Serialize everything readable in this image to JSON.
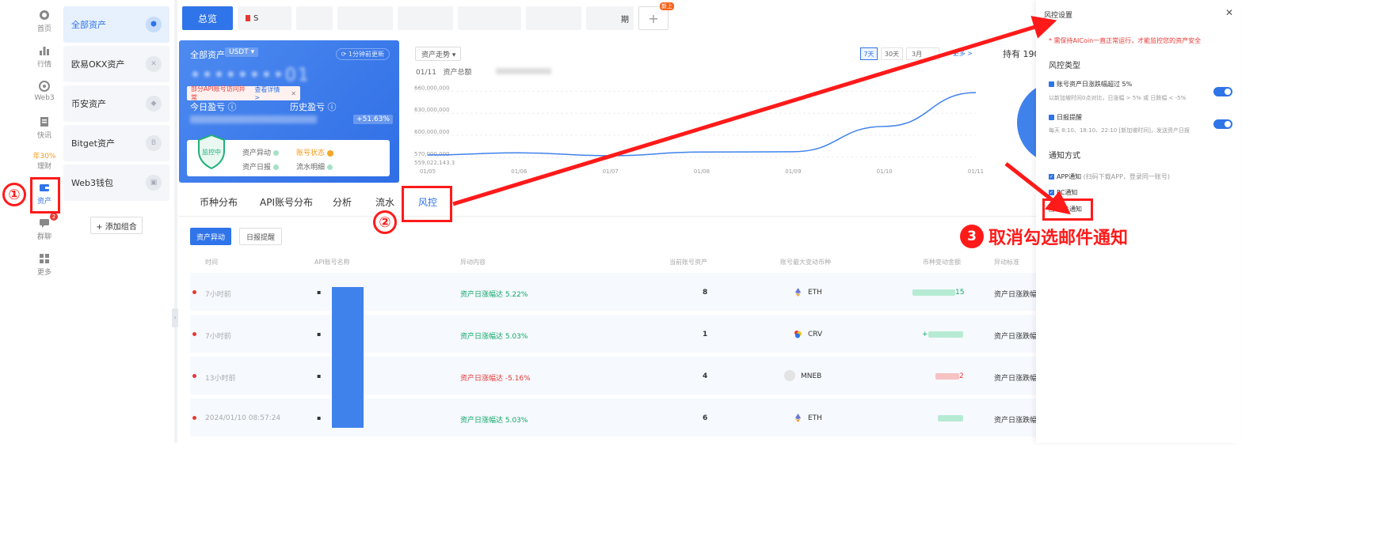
{
  "nav": [
    {
      "label": "首页",
      "icon": "home-icon"
    },
    {
      "label": "行情",
      "icon": "market-icon"
    },
    {
      "label": "Web3",
      "icon": "web3-icon"
    },
    {
      "label": "快讯",
      "icon": "news-icon"
    },
    {
      "annual": "年30%",
      "label": "理财",
      "icon": "finance-icon"
    },
    {
      "label": "资产",
      "icon": "wallet-icon"
    },
    {
      "label": "群聊",
      "icon": "chat-icon",
      "badge": "2"
    },
    {
      "label": "更多",
      "icon": "more-icon"
    }
  ],
  "accounts": [
    {
      "label": "全部资产",
      "badge": "⬢"
    },
    {
      "label": "欧易OKX资产",
      "badge": "✕"
    },
    {
      "label": "币安资产",
      "badge": "◆"
    },
    {
      "label": "Bitget资产",
      "badge": "B"
    },
    {
      "label": "Web3钱包",
      "badge": "▣"
    }
  ],
  "add_group": "+ 添加组合",
  "tabs": {
    "overview": "总览",
    "first_partial": "S",
    "last_partial": "期",
    "new_tag": "新上"
  },
  "summary": {
    "title": "全部资产",
    "unit": "USDT ▾",
    "refresh": "1分钟前更新",
    "amount_visible": "01",
    "alert": "部分API账号访问异常",
    "alert_link": "查看详情 >",
    "today_pnl": "今日盈亏",
    "history_pnl": "历史盈亏",
    "pct": "+51.63%",
    "shield": "监控中",
    "items": [
      "资产异动",
      "账号状态",
      "资产日报",
      "流水明细"
    ]
  },
  "chart_card": {
    "select": "资产走势 ▾",
    "date": "01/11",
    "total_label": "资产总额",
    "ranges": [
      "7天",
      "30天",
      "3月"
    ],
    "more": "更多 >"
  },
  "chart_data": {
    "type": "line",
    "x": [
      "01/05",
      "01/06",
      "01/07",
      "01/08",
      "01/09",
      "01/10",
      "01/11"
    ],
    "series": [
      {
        "values": [
          573000000,
          576000000,
          572000000,
          577000000,
          577500000,
          612000000,
          658000000
        ]
      }
    ],
    "y_ticks": [
      "660,000,000",
      "630,000,000",
      "600,000,000",
      "570,000,000"
    ],
    "ymin_label": "559,022,143.3",
    "ylim": [
      559000000,
      670000000
    ],
    "color": "#3f82ec"
  },
  "holdings": {
    "title": "持有 190"
  },
  "subtabs": [
    "币种分布",
    "API账号分布",
    "分析",
    "流水",
    "风控"
  ],
  "pills": [
    "资产异动",
    "日报提醒"
  ],
  "table": {
    "headers": [
      "时间",
      "API账号名称",
      "异动内容",
      "当前账号资产",
      "账号最大变动币种",
      "币种变动金额",
      "异动标准"
    ],
    "rows": [
      {
        "time": "7小时前",
        "content": "资产日涨幅达 5.22%",
        "dir": "up",
        "asset": "8",
        "coin": "ETH",
        "amount": "15",
        "rule": "资产日涨跌幅"
      },
      {
        "time": "7小时前",
        "content": "资产日涨幅达 5.03%",
        "dir": "up",
        "asset": "1",
        "coin": "CRV",
        "amount": "+",
        "rule": "资产日涨跌幅"
      },
      {
        "time": "13小时前",
        "content": "资产日涨幅达 -5.16%",
        "dir": "down",
        "asset": "4",
        "coin": "MNEB",
        "amount": "2",
        "rule": "资产日涨跌幅"
      },
      {
        "time": "2024/01/10 08:57:24",
        "content": "资产日涨幅达 5.03%",
        "dir": "up",
        "asset": "6",
        "coin": "ETH",
        "amount": "",
        "rule": "资产日涨跌幅"
      }
    ]
  },
  "risk_panel": {
    "title": "风控设置",
    "warning": "* 需保持AICoin一直正常运行，才能监控您的资产安全",
    "type_heading": "风控类型",
    "item1": "账号资产日涨跌幅超过 5%",
    "item1_sub": "以新加坡时间0点对比，日涨幅 > 5% 或 日跌幅 < -5%",
    "item2": "日报提醒",
    "item2_sub": "每天 8:10、18:10、22:10 [新加坡时间]，发送资产日报",
    "notify_heading": "通知方式",
    "notify": [
      {
        "label": "APP通知",
        "hint": "(扫码下载APP，登录同一账号)",
        "checked": true
      },
      {
        "label": "PC通知",
        "hint": "",
        "checked": true
      },
      {
        "label": "邮件通知",
        "hint": "",
        "checked": false
      }
    ]
  },
  "annotations": {
    "n1": "①",
    "n2": "②",
    "n3_num": "3",
    "n3_text": "取消勾选邮件通知"
  }
}
